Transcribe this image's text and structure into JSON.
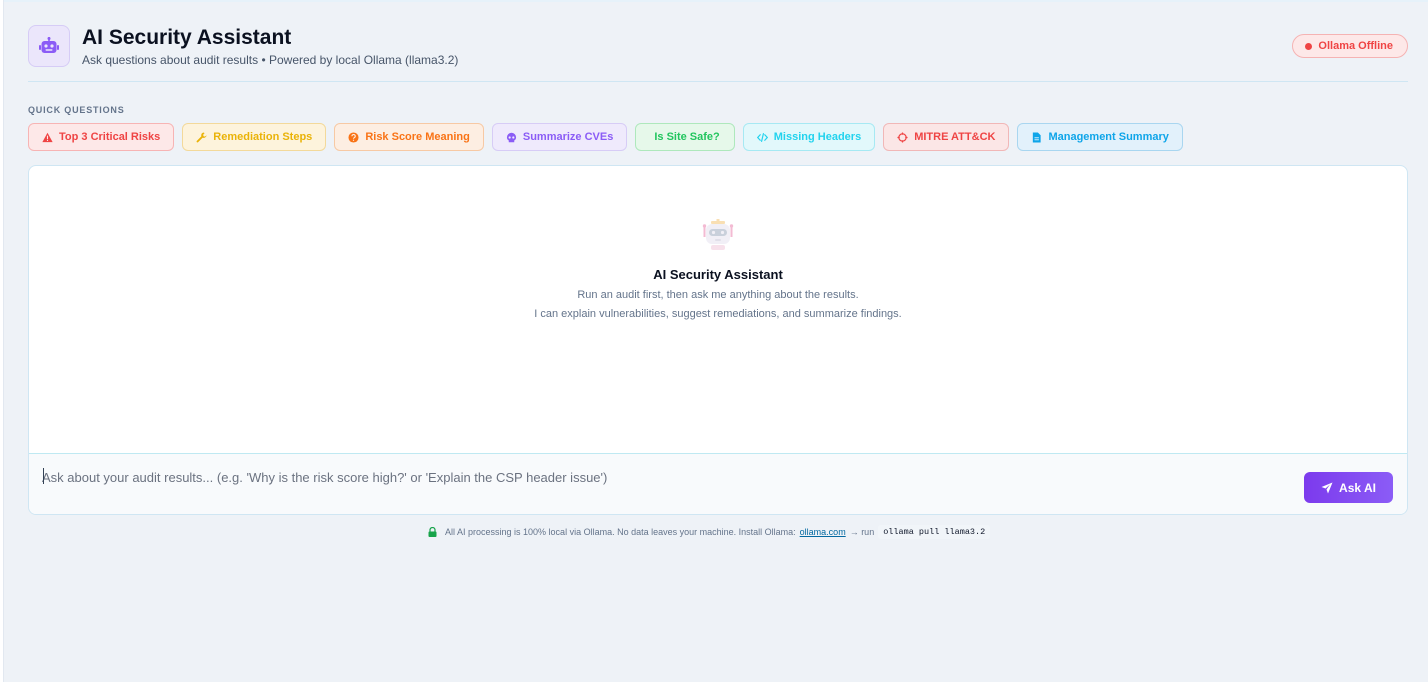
{
  "header": {
    "title": "AI Security Assistant",
    "subtitle": "Ask questions about audit results • Powered by local Ollama (llama3.2)",
    "logo_icon": "robot-icon",
    "status": {
      "label": "Ollama Offline",
      "color": "#ef4444"
    }
  },
  "quick_questions": {
    "label": "QUICK QUESTIONS",
    "buttons": [
      {
        "label": "Top 3 Critical Risks",
        "icon": "warning-triangle-icon",
        "color": "#ef4444"
      },
      {
        "label": "Remediation Steps",
        "icon": "wrench-icon",
        "color": "#eab308"
      },
      {
        "label": "Risk Score Meaning",
        "icon": "question-circle-icon",
        "color": "#f97316"
      },
      {
        "label": "Summarize CVEs",
        "icon": "skull-icon",
        "color": "#8b5cf6"
      },
      {
        "label": "Is Site Safe?",
        "icon": "",
        "color": "#22c55e"
      },
      {
        "label": "Missing Headers",
        "icon": "code-icon",
        "color": "#22d3ee"
      },
      {
        "label": "MITRE ATT&CK",
        "icon": "crosshair-icon",
        "color": "#ef4444"
      },
      {
        "label": "Management Summary",
        "icon": "document-icon",
        "color": "#0ea5e9"
      }
    ]
  },
  "chat": {
    "empty_title": "AI Security Assistant",
    "empty_line1": "Run an audit first, then ask me anything about the results.",
    "empty_line2": "I can explain vulnerabilities, suggest remediations, and summarize findings.",
    "input_placeholder": "Ask about your audit results... (e.g. 'Why is the risk score high?' or 'Explain the CSP header issue')",
    "ask_button": "Ask AI"
  },
  "footer": {
    "text": "All AI processing is 100% local via Ollama. No data leaves your machine. Install Ollama:",
    "link": "ollama.com",
    "run_text": "→ run",
    "command": "ollama pull llama3.2"
  }
}
